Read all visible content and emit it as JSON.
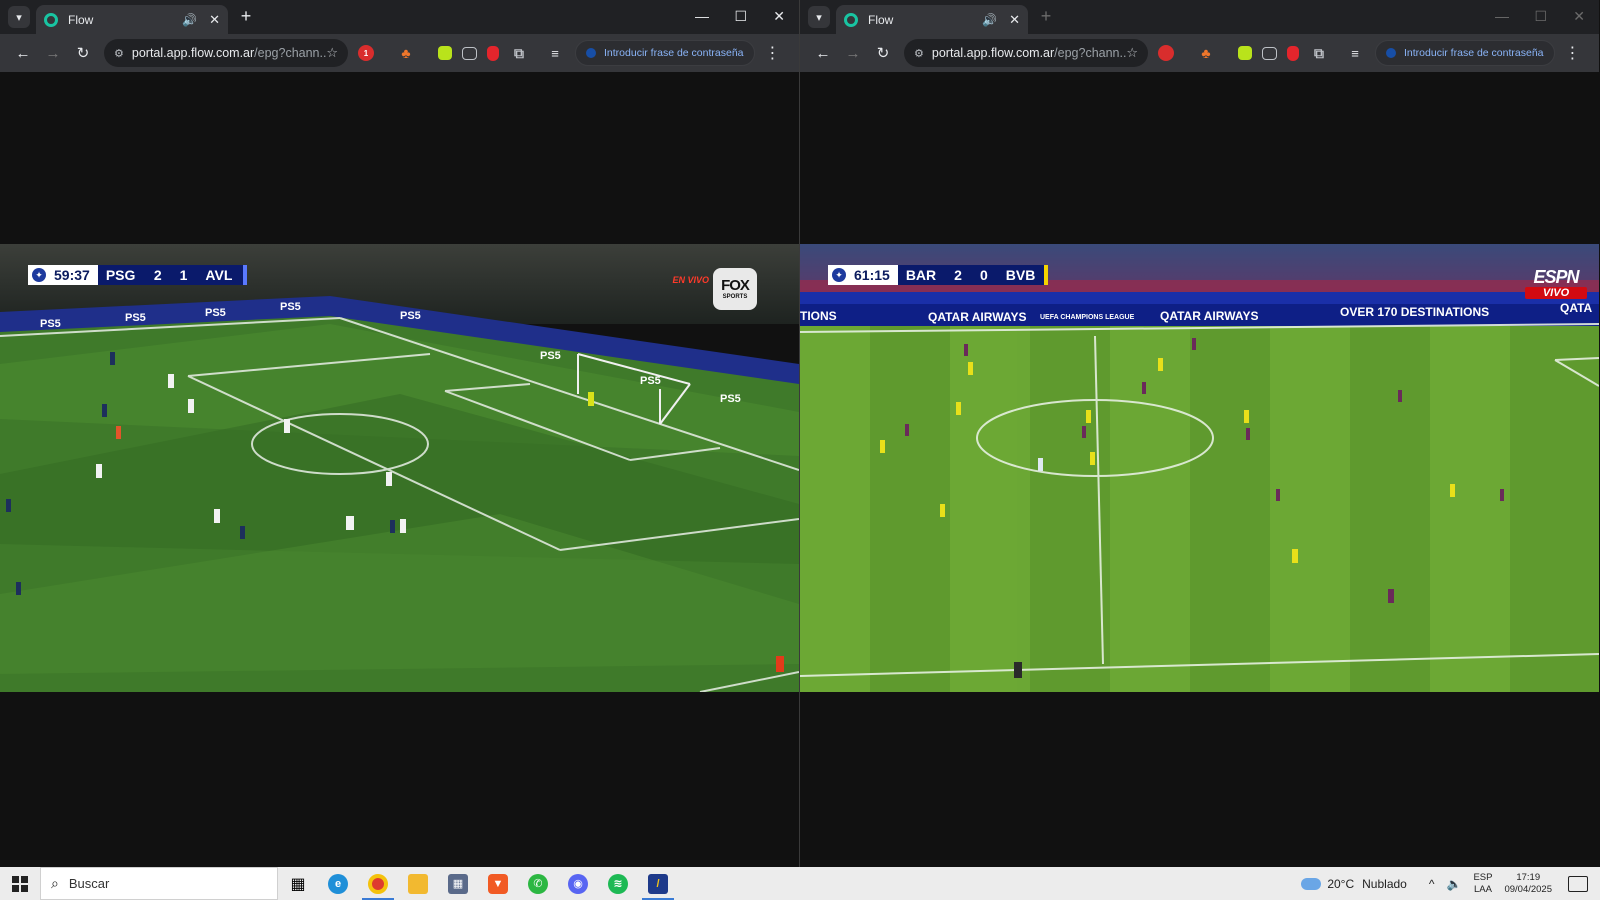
{
  "windows": [
    {
      "tab_title": "Flow",
      "url_host": "portal.app.flow.com.ar",
      "url_path": "/epg?chann...",
      "password_prompt": "Introducir frase de contraseña",
      "extension_badge": "1",
      "scorebug": {
        "clock": "59:37",
        "home": "PSG",
        "home_score": "2",
        "away_score": "1",
        "away": "AVL"
      },
      "broadcaster": {
        "logo": "FOX",
        "logo_sub": "SPORTS",
        "live_label": "EN VIVO"
      },
      "ad_board": [
        "PS5",
        "PS5",
        "PS5",
        "PS5",
        "PS5",
        "PS5",
        "PS5",
        "PS5"
      ]
    },
    {
      "tab_title": "Flow",
      "url_host": "portal.app.flow.com.ar",
      "url_path": "/epg?chann...",
      "password_prompt": "Introducir frase de contraseña",
      "scorebug": {
        "clock": "61:15",
        "home": "BAR",
        "home_score": "2",
        "away_score": "0",
        "away": "BVB"
      },
      "broadcaster": {
        "logo": "ESPN",
        "live_label": "VIVO"
      },
      "ad_board": [
        "TIONS",
        "QATAR AIRWAYS",
        "UEFA CHAMPIONS LEAGUE",
        "QATAR AIRWAYS",
        "OVER 170 DESTINATIONS",
        "QATA"
      ]
    }
  ],
  "taskbar": {
    "search_placeholder": "Buscar",
    "weather_temp": "20°C",
    "weather_desc": "Nublado",
    "lang_1": "ESP",
    "lang_2": "LAA",
    "time": "17:19",
    "date": "09/04/2025"
  },
  "colors": {
    "chrome_tab": "#35363a",
    "chrome_frame": "#202124",
    "pitch_dark": "#2f5a24",
    "pitch_light": "#4a8a2c",
    "scorebug_navy": "#0a1a6b",
    "espn_red": "#d20a11"
  }
}
